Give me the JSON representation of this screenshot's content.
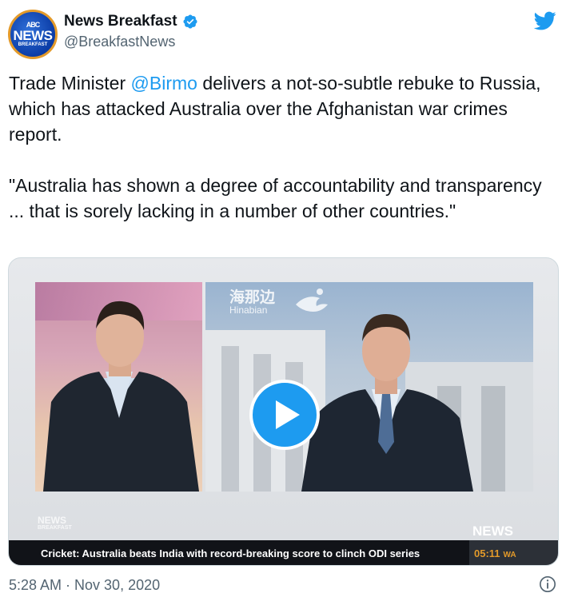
{
  "author": {
    "display_name": "News Breakfast",
    "handle": "@BreakfastNews",
    "avatar_text": {
      "top": "ABC",
      "middle": "NEWS",
      "bottom": "BREAKFAST"
    }
  },
  "tweet": {
    "line1_pre": "Trade Minister ",
    "mention": "@Birmo",
    "line1_post": " delivers a not-so-subtle rebuke to Russia, which has attacked Australia over the Afghanistan war crimes report.",
    "quote": "\"Australia has shown a degree of accountability and transparency ... that is sorely lacking in a number of other countries.\""
  },
  "video": {
    "watermark_cn": "海那边",
    "watermark_latin": "Hinabian",
    "corner_logo_top": "NEWS",
    "corner_logo_bottom": "BREAKFAST",
    "network_logo": "NEWS",
    "ticker": "Cricket: Australia beats India with record-breaking score to clinch ODI series",
    "clock_time": "05:11",
    "clock_zone": "WA"
  },
  "footer": {
    "timestamp": "5:28 AM · Nov 30, 2020"
  },
  "colors": {
    "link": "#1d9bf0",
    "secondary_text": "#536471",
    "clock": "#e39a2a"
  },
  "icons": [
    "verified-badge-icon",
    "twitter-bird-icon",
    "play-icon",
    "info-icon"
  ]
}
